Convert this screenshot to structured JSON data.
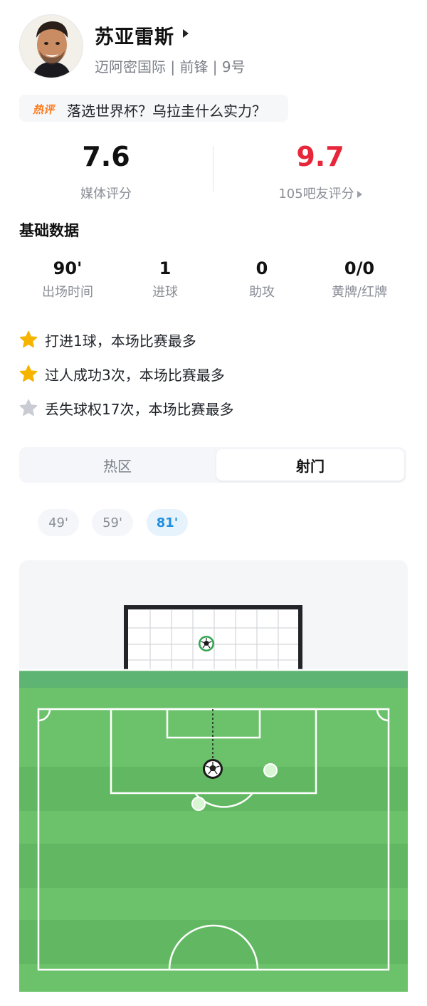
{
  "player": {
    "name": "苏亚雷斯",
    "team_line": "迈阿密国际 | 前锋 | 9号"
  },
  "hot_topic": {
    "tag": "热评",
    "text": "落选世界杯？乌拉圭什么实力？"
  },
  "ratings": {
    "media_score": "7.6",
    "media_label": "媒体评分",
    "fans_score": "9.7",
    "fans_label": "105吧友评分"
  },
  "basic_stats": {
    "title": "基础数据",
    "items": [
      {
        "value": "90'",
        "label": "出场时间"
      },
      {
        "value": "1",
        "label": "进球"
      },
      {
        "value": "0",
        "label": "助攻"
      },
      {
        "value": "0/0",
        "label": "黄牌/红牌"
      }
    ]
  },
  "highlights": [
    {
      "text": "打进1球，本场比赛最多",
      "star": "gold-star-icon"
    },
    {
      "text": "过人成功3次，本场比赛最多",
      "star": "gold-star-icon"
    },
    {
      "text": "丢失球权17次，本场比赛最多",
      "star": "gray-star-icon"
    }
  ],
  "tabs": {
    "heat_label": "热区",
    "shots_label": "射门",
    "active": "射门"
  },
  "shot_minutes": [
    {
      "label": "49'",
      "active": false
    },
    {
      "label": "59'",
      "active": false
    },
    {
      "label": "81'",
      "active": true
    }
  ],
  "colors": {
    "fans_score": "#e8263a",
    "hot_tag": "#ff7a1a",
    "active_chip_text": "#1f8fe0",
    "pitch_stripe_light": "#6cc26b",
    "pitch_stripe_dark": "#62b862",
    "star_gold": "#f5b400",
    "star_gray": "#c9ccd3"
  }
}
